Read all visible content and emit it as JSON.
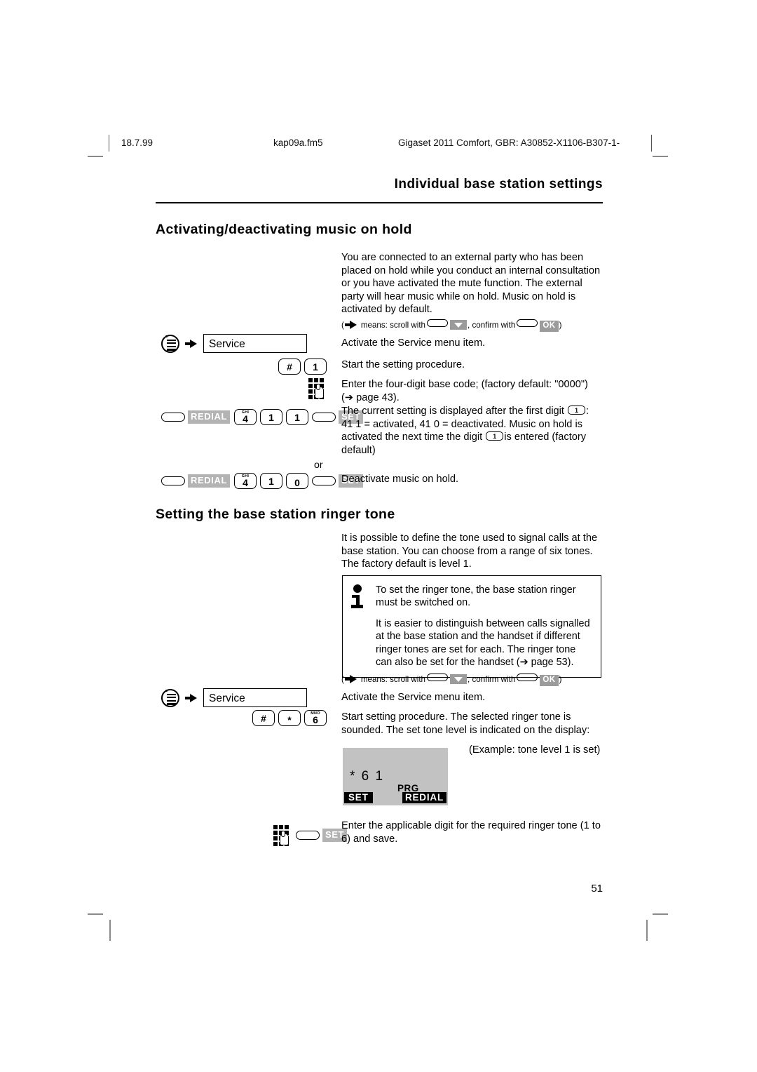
{
  "header": {
    "date": "18.7.99",
    "filename": "kap09a.fm5",
    "document_id": "Gigaset 2011 Comfort, GBR: A30852-X1106-B307-1-"
  },
  "chapter_title": "Individual base station settings",
  "page_number": "51",
  "sections": [
    {
      "heading": "Activating/deactivating music on hold",
      "intro": "You are connected to an external party who has been placed on hold while you conduct an internal consultation or you have activated the mute function. The external party will hear music while on hold. Music on hold is activated by default.",
      "legend": {
        "prefix": "(",
        "means": "means: scroll with",
        "confirm": ", confirm with",
        "ok_label": "OK",
        "suffix": ")"
      },
      "steps": [
        {
          "menu_item": "Service",
          "text": "Activate the Service menu item."
        },
        {
          "keys": [
            "#",
            "1"
          ],
          "text": "Start the setting procedure."
        },
        {
          "text": "Enter the four-digit base code; (factory default: \"0000\") (➔ page 43)."
        },
        {
          "keys_row": [
            "REDIAL",
            "4",
            "1",
            "1",
            "SET"
          ],
          "text_before": "The current setting is displayed after the first digit",
          "text_after": ": 41 1 = activated, 41 0 = deactivated. Music on hold is activated the next time the digit",
          "text_end": "is entered (factory default)",
          "inline_key": "1"
        },
        {
          "or": "or",
          "keys_row": [
            "REDIAL",
            "4",
            "1",
            "0",
            "SET"
          ],
          "text": "Deactivate music on hold."
        }
      ]
    },
    {
      "heading": "Setting the base station ringer tone",
      "intro": "It is possible to define the tone used to signal calls at the base station. You can choose from a range of six tones. The factory default is level 1.",
      "note": {
        "paragraph1": "To set the ringer tone, the base station ringer must be switched on.",
        "paragraph2": "It is easier to distinguish between calls signalled at the base station and the handset if different ringer tones are set for each. The ringer tone can also be set for the handset (➔ page 53)."
      },
      "legend": {
        "prefix": "(",
        "means": "means: scroll with",
        "confirm": ", confirm with",
        "ok_label": "OK",
        "suffix": ")"
      },
      "steps": [
        {
          "menu_item": "Service",
          "text": "Activate the Service menu item."
        },
        {
          "keys": [
            "#",
            "*",
            "6"
          ],
          "text": "Start setting procedure. The selected ringer tone is sounded. The set tone level is indicated on the display:"
        },
        {
          "example_text": "(Example: tone level 1 is set)"
        },
        {
          "keys_row": [
            "keypad",
            "SET"
          ],
          "text": "Enter the applicable digit for the required ringer tone (1 to 6) and save."
        }
      ]
    }
  ],
  "lcd_display": {
    "line1": "* 6 1",
    "prg_label": "PRG",
    "softkey_left": "SET",
    "softkey_right": "REDIAL"
  },
  "keys": {
    "hash": "#",
    "star": "*",
    "star_sub": "",
    "one": "1",
    "one_sub": "",
    "zero": "0",
    "zero_sub": "",
    "four": "4",
    "four_sub": "GHI",
    "six": "6",
    "six_sub": "MNO"
  },
  "labels": {
    "redial": "REDIAL",
    "set": "SET",
    "or": "or"
  },
  "colors": {
    "page_bg": "#ffffff",
    "text": "#000000",
    "inverse_label_bg": "#b3b3b3",
    "lcd_bg": "#c2c2c2",
    "crop_mark": "#8a8a8a"
  }
}
